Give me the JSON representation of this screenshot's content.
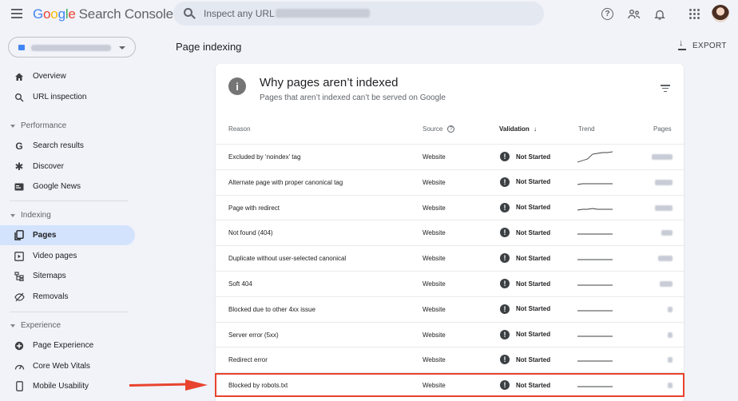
{
  "app": {
    "logo_parts": [
      "G",
      "o",
      "o",
      "g",
      "l",
      "e"
    ],
    "product": "Search Console"
  },
  "search": {
    "placeholder": "Inspect any URL in"
  },
  "icons": {
    "menu": "hamburger-icon",
    "help": "help-icon",
    "people": "people-icon",
    "bell": "notifications-icon",
    "apps": "apps-grid-icon",
    "avatar": "account-avatar"
  },
  "sidebar": {
    "items": [
      {
        "label": "Overview",
        "icon": "home-icon",
        "glyph": "⌂"
      },
      {
        "label": "URL inspection",
        "icon": "search-icon",
        "glyph": "⚲"
      },
      {
        "label": "Search results",
        "icon": "google-g-icon",
        "glyph": "G"
      },
      {
        "label": "Discover",
        "icon": "discover-asterisk-icon",
        "glyph": "✱"
      },
      {
        "label": "Google News",
        "icon": "news-icon",
        "glyph": "▭"
      },
      {
        "label": "Pages",
        "icon": "pages-icon",
        "glyph": "⧉",
        "active": true
      },
      {
        "label": "Video pages",
        "icon": "video-pages-icon",
        "glyph": "▣"
      },
      {
        "label": "Sitemaps",
        "icon": "sitemap-icon",
        "glyph": "⊞"
      },
      {
        "label": "Removals",
        "icon": "removals-icon",
        "glyph": "⊘"
      },
      {
        "label": "Page Experience",
        "icon": "page-experience-icon",
        "glyph": "✚"
      },
      {
        "label": "Core Web Vitals",
        "icon": "gauge-icon",
        "glyph": "◔"
      },
      {
        "label": "Mobile Usability",
        "icon": "mobile-icon",
        "glyph": "▯"
      }
    ],
    "sections": [
      "Performance",
      "Indexing",
      "Experience"
    ]
  },
  "main": {
    "title": "Page indexing",
    "export_label": "EXPORT"
  },
  "card": {
    "title": "Why pages aren’t indexed",
    "subtitle": "Pages that aren’t indexed can’t be served on Google",
    "info_glyph": "i",
    "columns": {
      "reason": "Reason",
      "source": "Source",
      "source_help": "?",
      "validation": "Validation",
      "validation_sort": "↓",
      "trend": "Trend",
      "pages": "Pages"
    },
    "rows": [
      {
        "reason": "Excluded by ‘noindex’ tag",
        "source": "Website",
        "validation": "Not Started",
        "trend": [
          0.2,
          0.3,
          0.4,
          0.7,
          0.75,
          0.8,
          0.8,
          0.85
        ],
        "pages_blur_width": 26
      },
      {
        "reason": "Alternate page with proper canonical tag",
        "source": "Website",
        "validation": "Not Started",
        "trend": [
          0.4,
          0.45,
          0.45,
          0.45,
          0.45,
          0.45,
          0.45,
          0.45
        ],
        "pages_blur_width": 22
      },
      {
        "reason": "Page with redirect",
        "source": "Website",
        "validation": "Not Started",
        "trend": [
          0.4,
          0.45,
          0.45,
          0.5,
          0.45,
          0.45,
          0.45,
          0.45
        ],
        "pages_blur_width": 22
      },
      {
        "reason": "Not found (404)",
        "source": "Website",
        "validation": "Not Started",
        "trend": [
          0.45,
          0.45,
          0.45,
          0.45,
          0.45,
          0.45,
          0.45,
          0.45
        ],
        "pages_blur_width": 14
      },
      {
        "reason": "Duplicate without user-selected canonical",
        "source": "Website",
        "validation": "Not Started",
        "trend": [
          0.45,
          0.45,
          0.45,
          0.45,
          0.45,
          0.45,
          0.45,
          0.45
        ],
        "pages_blur_width": 18
      },
      {
        "reason": "Soft 404",
        "source": "Website",
        "validation": "Not Started",
        "trend": [
          0.45,
          0.45,
          0.45,
          0.45,
          0.45,
          0.45,
          0.45,
          0.45
        ],
        "pages_blur_width": 16
      },
      {
        "reason": "Blocked due to other 4xx issue",
        "source": "Website",
        "validation": "Not Started",
        "trend": [
          0.45,
          0.45,
          0.45,
          0.45,
          0.45,
          0.45,
          0.45,
          0.45
        ],
        "pages_blur_width": 6
      },
      {
        "reason": "Server error (5xx)",
        "source": "Website",
        "validation": "Not Started",
        "trend": [
          0.45,
          0.45,
          0.45,
          0.45,
          0.45,
          0.45,
          0.45,
          0.45
        ],
        "pages_blur_width": 6
      },
      {
        "reason": "Redirect error",
        "source": "Website",
        "validation": "Not Started",
        "trend": [
          0.45,
          0.45,
          0.45,
          0.45,
          0.45,
          0.45,
          0.45,
          0.45
        ],
        "pages_blur_width": 6
      },
      {
        "reason": "Blocked by robots.txt",
        "source": "Website",
        "validation": "Not Started",
        "trend": [
          0.45,
          0.45,
          0.45,
          0.45,
          0.45,
          0.45,
          0.45,
          0.45
        ],
        "pages_blur_width": 6,
        "highlighted": true
      }
    ]
  },
  "colors": {
    "accent": "#1a73e8",
    "active_nav_bg": "#d3e3fd",
    "highlight": "#e8432e",
    "background": "#f1f3f9"
  }
}
